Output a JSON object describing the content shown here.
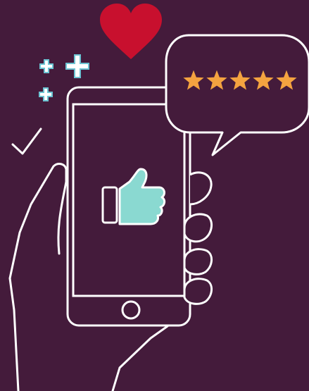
{
  "illustration": {
    "background_color": "#441B3B",
    "line_color": "#FFFFFF",
    "heart_color": "#C8102E",
    "star_color": "#F4A340",
    "thumb_color": "#8AD9D1",
    "sparkle_color": "#6CC3D2",
    "icons": [
      "heart-icon",
      "sparkle-icon",
      "checkmark-icon",
      "phone-icon",
      "hand-icon",
      "thumbs-up-icon",
      "speech-bubble-icon",
      "star-icon"
    ]
  },
  "rating": {
    "stars_filled": 5,
    "stars_total": 5
  }
}
